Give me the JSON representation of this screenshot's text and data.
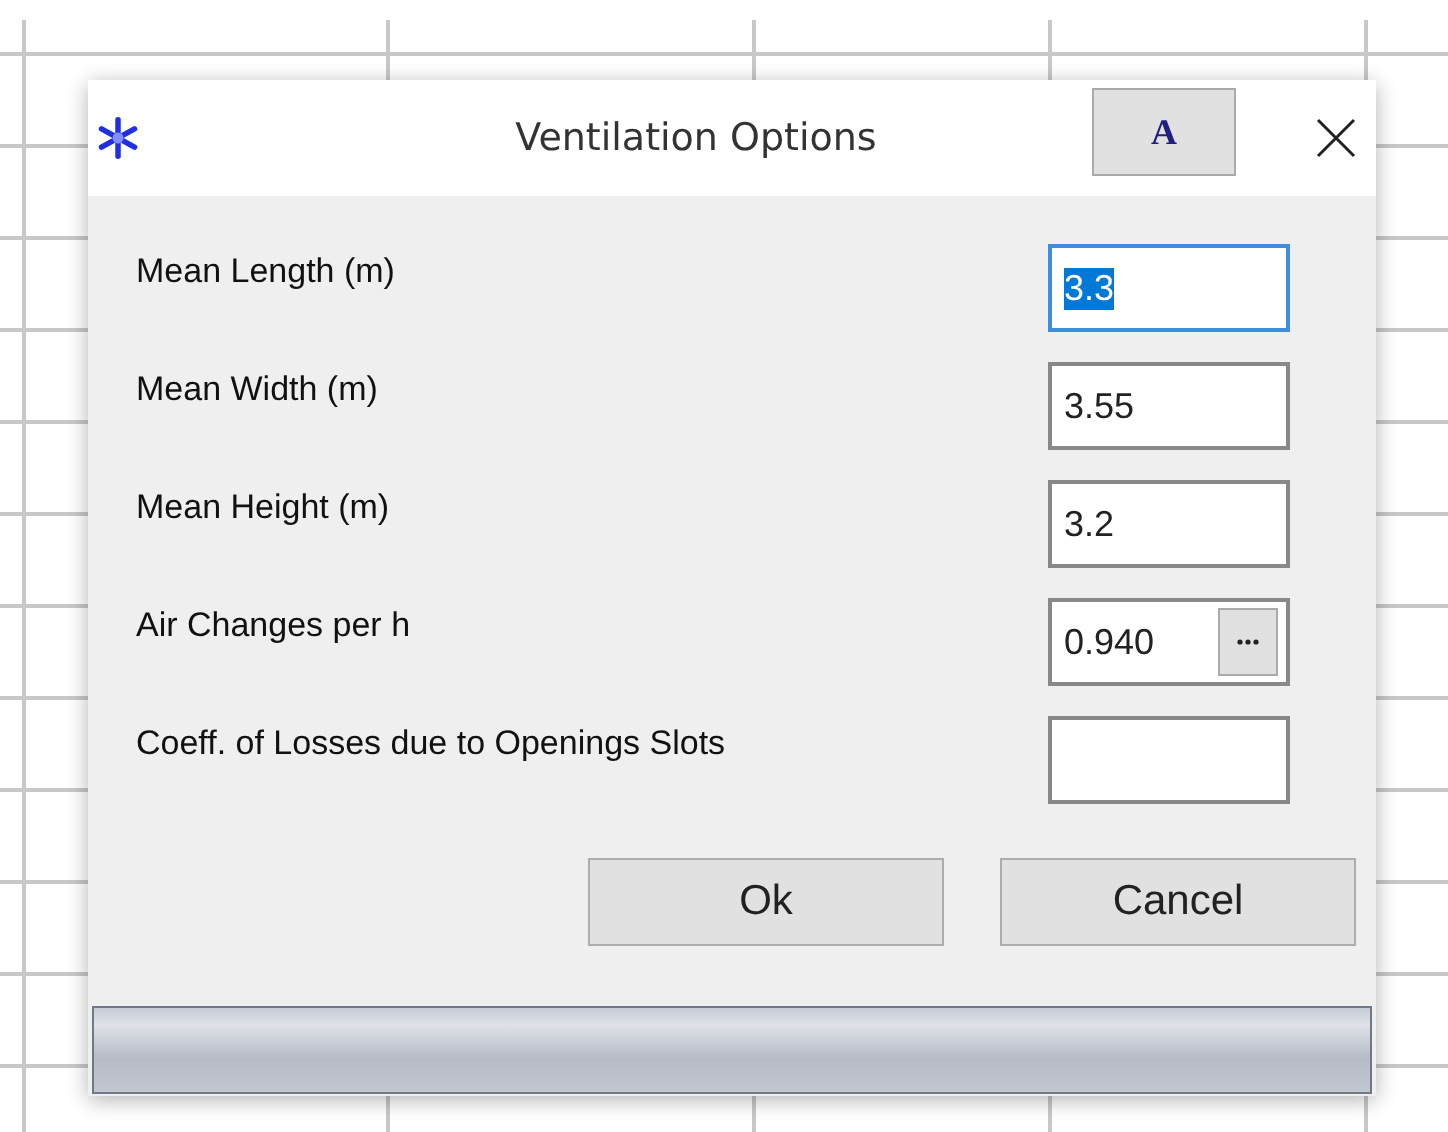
{
  "window": {
    "title": "Ventilation Options",
    "font_button": "A"
  },
  "fields": [
    {
      "label": "Mean Length (m)",
      "value": "3.3",
      "kind": "text",
      "focused": true
    },
    {
      "label": "Mean Width (m)",
      "value": "3.55",
      "kind": "text",
      "focused": false
    },
    {
      "label": "Mean Height (m)",
      "value": "3.2",
      "kind": "text",
      "focused": false
    },
    {
      "label": "Air Changes per h",
      "value": "0.940",
      "kind": "picker",
      "focused": false
    },
    {
      "label": "Coeff. of Losses due to Openings Slots",
      "kind": "text",
      "focused": false
    }
  ],
  "buttons": [
    "Ok",
    "Cancel"
  ]
}
